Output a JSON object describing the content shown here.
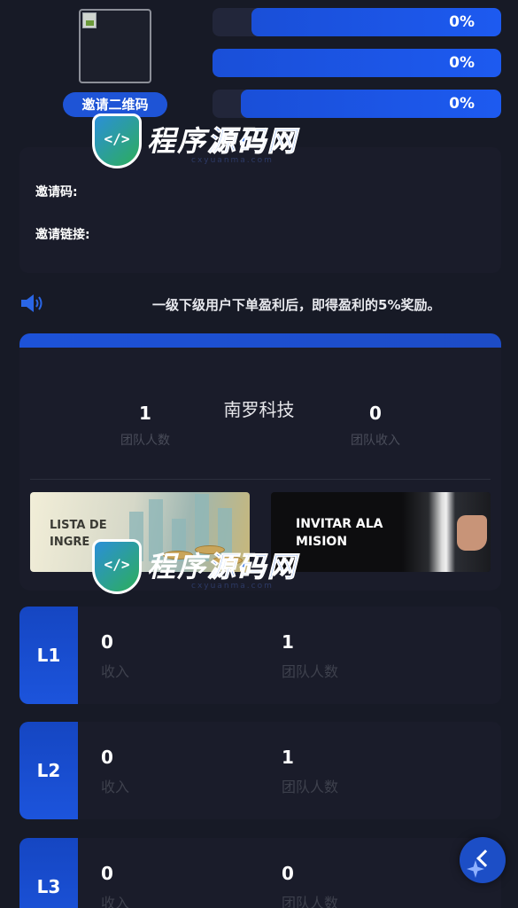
{
  "header": {
    "qr_button_label": "邀请二维码",
    "progress_bars": [
      {
        "text": "0%",
        "value": 0
      },
      {
        "text": "0%",
        "value": 0
      },
      {
        "text": "0%",
        "value": 0
      }
    ]
  },
  "invite": {
    "code_label": "邀请码:",
    "link_label": "邀请链接:"
  },
  "notice": {
    "text": "一级下级用户下单盈利后，即得盈利的5%奖励。"
  },
  "team": {
    "name": "南罗科技",
    "members_value": "1",
    "members_label": "团队人数",
    "income_value": "0",
    "income_label": "团队收入"
  },
  "banners": {
    "left_line1": "LISTA DE",
    "left_line2": "INGRE",
    "right_line1": "INVITAR ALA",
    "right_line2": "MISION"
  },
  "levels": [
    {
      "badge": "L1",
      "income_value": "0",
      "income_label": "收入",
      "members_value": "1",
      "members_label": "团队人数"
    },
    {
      "badge": "L2",
      "income_value": "0",
      "income_label": "收入",
      "members_value": "1",
      "members_label": "团队人数"
    },
    {
      "badge": "L3",
      "income_value": "0",
      "income_label": "收入",
      "members_value": "0",
      "members_label": "团队人数"
    }
  ],
  "watermark": {
    "code_glyph": "</>",
    "title_part1": "程序",
    "title_part2": "源码网",
    "subtitle": "cxyuanma.com"
  },
  "colors": {
    "accent": "#1e54d6",
    "background": "#171a26",
    "card": "#1a1c2a"
  },
  "icons": {
    "notice": "speaker-icon",
    "fab": "back-chevron-icon"
  }
}
